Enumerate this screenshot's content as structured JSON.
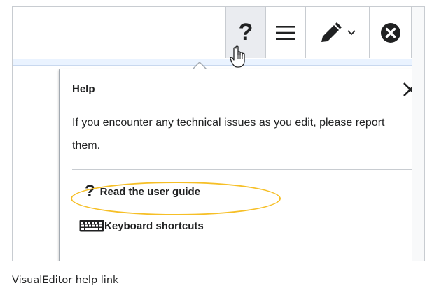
{
  "toolbar": {
    "help_icon": "question-mark-icon",
    "help_glyph": "?",
    "menu_icon": "hamburger-menu-icon",
    "edit_icon": "pencil-dropdown-icon",
    "close_icon": "close-circle-icon"
  },
  "popup": {
    "title": "Help",
    "message": "If you encounter any technical issues as you edit, please report them.",
    "close_icon": "close-x-icon",
    "links": [
      {
        "label": "Read the user guide",
        "icon": "question-mark-icon",
        "glyph": "?",
        "highlighted": true
      },
      {
        "label": "Keyboard shortcuts",
        "icon": "keyboard-icon"
      }
    ]
  },
  "caption": "VisualEditor help link",
  "colors": {
    "highlight": "#f6bf26",
    "text": "#202122",
    "border": "#a2a9b1",
    "active_tool_bg": "#eaecf0"
  }
}
